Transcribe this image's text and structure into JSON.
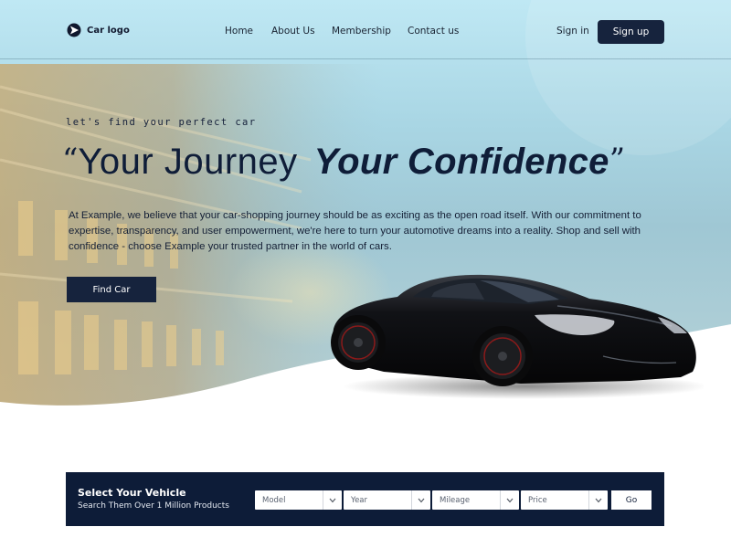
{
  "header": {
    "logo_text": "Car logo",
    "nav": [
      "Home",
      "About Us",
      "Membership",
      "Contact us"
    ],
    "sign_in": "Sign in",
    "sign_up": "Sign up"
  },
  "hero": {
    "tagline": "let's find your perfect car",
    "open_quote": "“",
    "headline_part1": "Your Journey",
    "headline_part2": "Your Confidence",
    "close_quote": "”",
    "description": "At Example, we believe that your car-shopping journey should be as exciting as the open road itself. With our commitment to expertise, transparency, and user empowerment, we're here to turn your automotive dreams into a reality. Shop and sell with confidence - choose Example your trusted partner in the world of cars.",
    "cta": "Find Car"
  },
  "search": {
    "title": "Select Your Vehicle",
    "subtitle": "Search  Them Over 1 Million Products",
    "filters": [
      "Model",
      "Year",
      "Mileage",
      "Price"
    ],
    "go": "Go"
  },
  "colors": {
    "primary_dark": "#16233d",
    "search_bg": "#0d1c38",
    "hero_sky": "#a9d6e4"
  },
  "icons": {
    "logo": "play-triangle-icon",
    "select_chevron": "chevron-down-icon"
  }
}
